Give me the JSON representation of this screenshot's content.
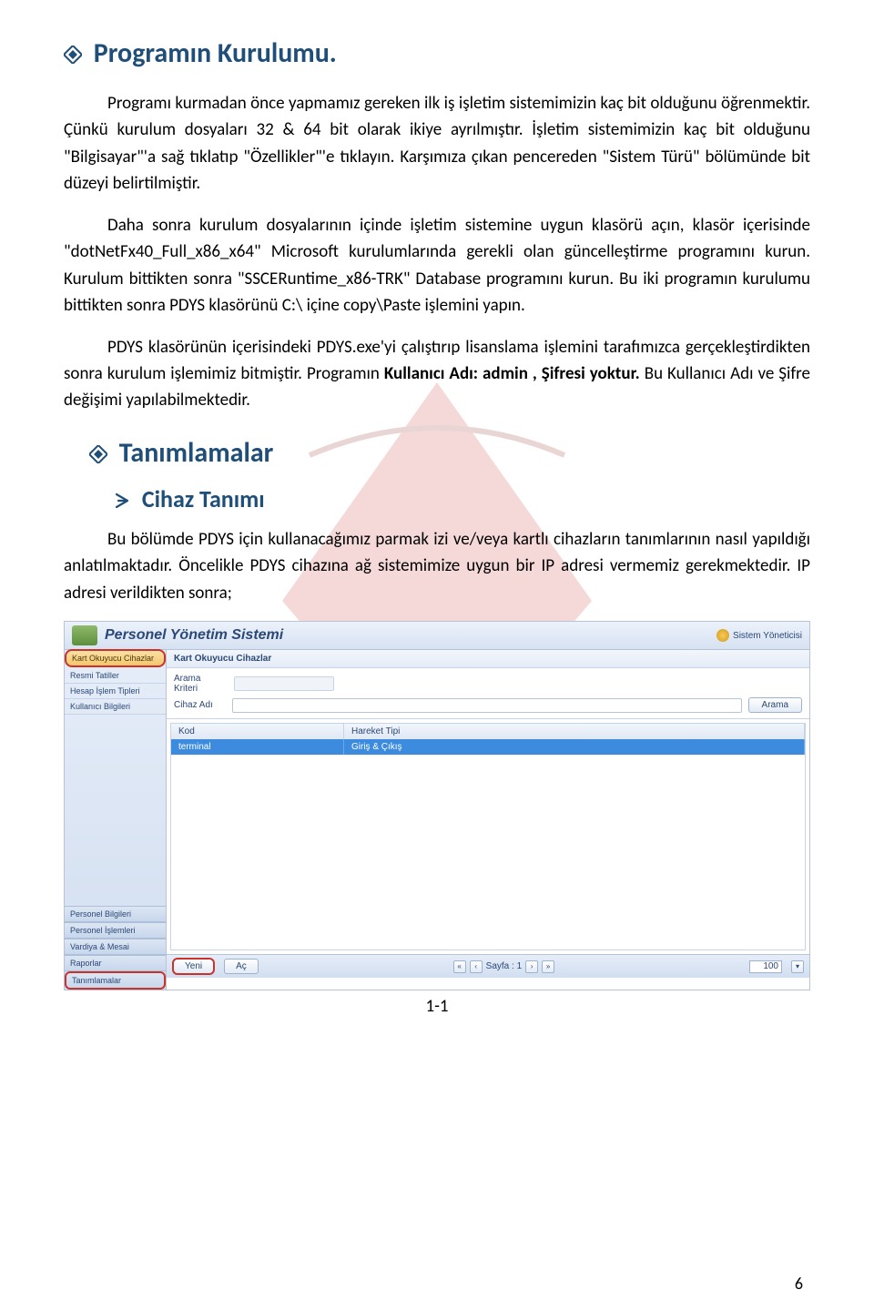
{
  "headings": {
    "h1": "Programın Kurulumu.",
    "h2": "Tanımlamalar",
    "h3": "Cihaz Tanımı"
  },
  "paragraphs": {
    "p1": "Programı kurmadan önce yapmamız gereken ilk iş işletim sistemimizin kaç bit olduğunu öğrenmektir. Çünkü kurulum dosyaları 32 & 64 bit olarak ikiye ayrılmıştır. İşletim sistemimizin kaç bit olduğunu \"Bilgisayar\"'a sağ tıklatıp \"Özellikler\"'e tıklayın. Karşımıza çıkan pencereden \"Sistem Türü\" bölümünde bit düzeyi belirtilmiştir.",
    "p2": "Daha sonra kurulum dosyalarının içinde işletim sistemine uygun klasörü açın, klasör içerisinde \"dotNetFx40_Full_x86_x64\" Microsoft kurulumlarında gerekli olan güncelleştirme programını kurun. Kurulum bittikten sonra \"SSCERuntime_x86-TRK\" Database programını kurun. Bu iki programın kurulumu bittikten sonra PDYS klasörünü C:\\ içine copy\\Paste işlemini yapın.",
    "p3a": "PDYS klasörünün içerisindeki PDYS.exe'yi çalıştırıp lisanslama işlemini tarafımızca gerçekleştirdikten sonra kurulum işlemimiz bitmiştir.  Programın ",
    "p3b": "Kullanıcı Adı: admin , Şifresi yoktur. ",
    "p3c": "Bu Kullanıcı Adı ve Şifre değişimi yapılabilmektedir.",
    "p4": "Bu bölümde PDYS için kullanacağımız parmak izi ve/veya kartlı cihazların tanımlarının nasıl yapıldığı anlatılmaktadır. Öncelikle PDYS cihazına ağ sistemimize uygun bir IP adresi vermemiz gerekmektedir. IP adresi verildikten sonra;"
  },
  "app": {
    "title": "Personel Yönetim Sistemi",
    "sysadmin": "Sistem Yöneticisi",
    "sidebar": {
      "active": "Kart Okuyucu Cihazlar",
      "items": [
        "Resmi Tatiller",
        "Hesap İşlem Tipleri",
        "Kullanıcı Bilgileri"
      ],
      "groups": [
        "Personel Bilgileri",
        "Personel İşlemleri",
        "Vardiya & Mesai",
        "Raporlar",
        "Tanımlamalar"
      ]
    },
    "crumb": "Kart Okuyucu Cihazlar",
    "search": {
      "arama_kriteri": "Arama Kriteri",
      "cihaz_adi": "Cihaz Adı",
      "btn": "Arama"
    },
    "grid": {
      "col_kod": "Kod",
      "col_hareket": "Hareket Tipi",
      "row_kod": "terminal",
      "row_hareket": "Giriş & Çıkış"
    },
    "bottom": {
      "yeni": "Yeni",
      "ac": "Aç",
      "sayfa": "Sayfa : 1",
      "perpage": "100"
    }
  },
  "figure_caption": "1-1",
  "page_number": "6"
}
